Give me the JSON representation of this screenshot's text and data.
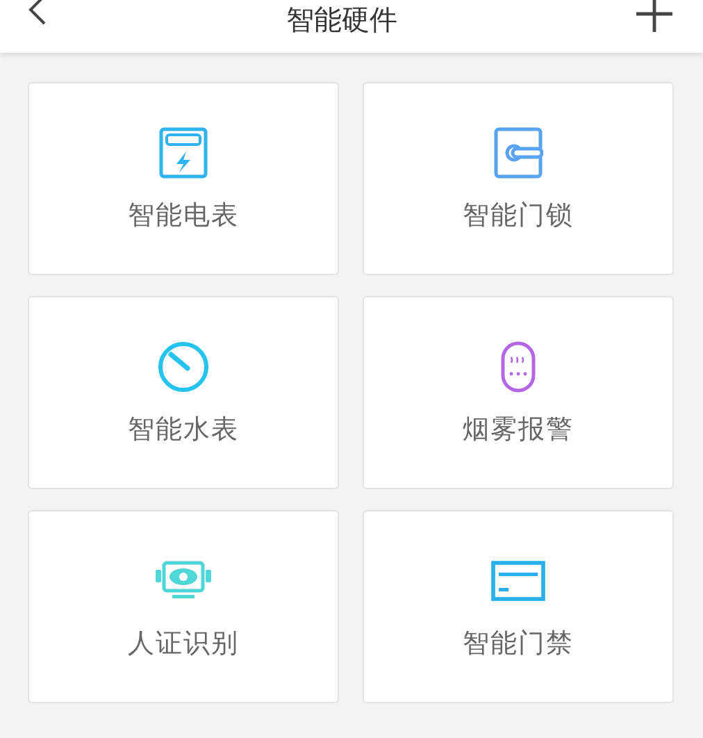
{
  "header": {
    "title": "智能硬件"
  },
  "devices": [
    {
      "kind": "meter",
      "label": "智能电表"
    },
    {
      "kind": "lock",
      "label": "智能门锁"
    },
    {
      "kind": "water",
      "label": "智能水表"
    },
    {
      "kind": "smoke",
      "label": "烟雾报警"
    },
    {
      "kind": "id",
      "label": "人证识别"
    },
    {
      "kind": "access",
      "label": "智能门禁"
    }
  ]
}
